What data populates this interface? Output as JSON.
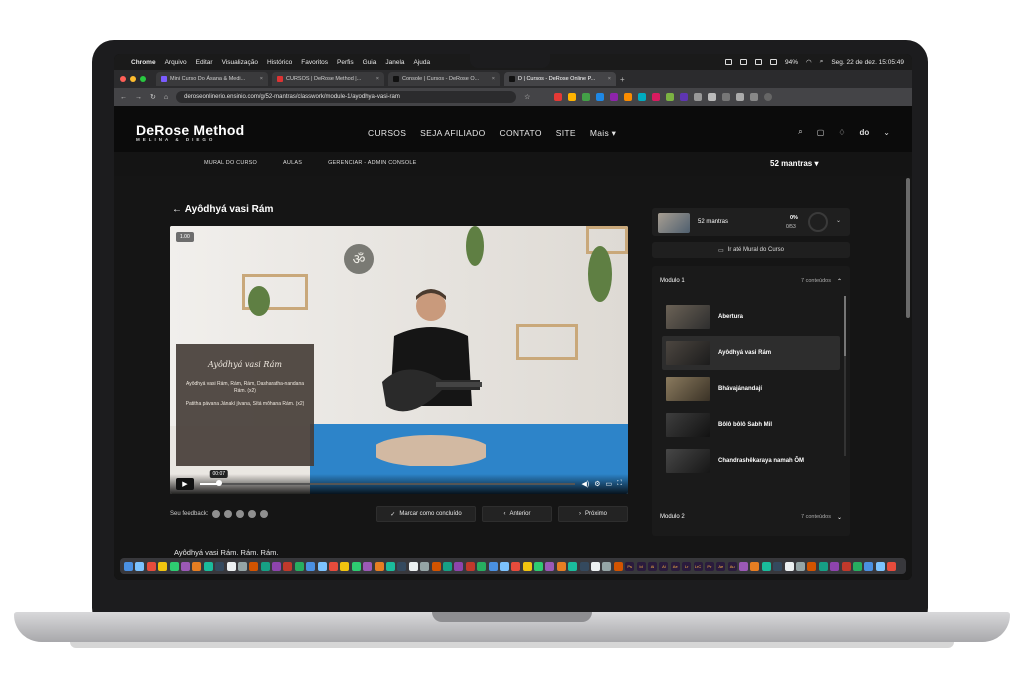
{
  "menubar": {
    "app": "Chrome",
    "items": [
      "Arquivo",
      "Editar",
      "Visualização",
      "Histórico",
      "Favoritos",
      "Perfis",
      "Guia",
      "Janela",
      "Ajuda"
    ],
    "battery": "94%",
    "datetime": "Seg. 22 de dez.  15:05:49"
  },
  "tabs": [
    {
      "label": "Mini Curso Do Ásana & Medi..."
    },
    {
      "label": "CURSOS | DeRose Method |..."
    },
    {
      "label": "Console | Cursos - DeRose O..."
    },
    {
      "label": "D | Cursos - DeRose Online P..."
    }
  ],
  "address": {
    "url": "deroseonlinerio.ensinio.com/g/52-mantras/classwork/module-1/ayodhya-vasi-ram"
  },
  "site": {
    "logo": "DeRose Method",
    "logo_sub": "MELINA & DIEGO",
    "nav": [
      "CURSOS",
      "SEJA AFILIADO",
      "CONTATO",
      "SITE",
      "Mais ▾"
    ],
    "avatar_text": "do"
  },
  "subnav": {
    "links": [
      "MURAL DO CURSO",
      "AULAS",
      "GERENCIAR - ADMIN CONSOLE"
    ],
    "course_selector": "52 mantras  ▾"
  },
  "lesson": {
    "title": "Ayôdhyá vasi Rám",
    "video_badge": "1.00",
    "card_title": "Ayôdhyá vasi Rám",
    "card_verse1": "Ayôdhyá vasi Rám, Rám, Rám, Dasharatha-nandana Rám. (x2)",
    "card_verse2": "Patitha pávana Jánakí jívana, Sítá môhana Rám. (x2)",
    "time_tooltip": "00:07",
    "progress_fraction": 0.05,
    "feedback_label": "Seu feedback:",
    "mark_done": "Marcar como concluído",
    "prev": "Anterior",
    "next": "Próximo",
    "body_text": "Ayôdhyá vasi Rám. Rám. Rám."
  },
  "panel": {
    "course_name": "52 mantras",
    "percent": "0%",
    "count": "0/53",
    "mural_button": "Ir até Mural do Curso",
    "module1": {
      "title": "Modulo 1",
      "count": "7 conteúdos",
      "lessons": [
        "Abertura",
        "Ayôdhyá vasi Rám",
        "Bhávajánandají",
        "Bôlô bôlô Sabh Mil",
        "Chandrashêkaraya namah ÔM"
      ]
    },
    "module2": {
      "title": "Modulo 2",
      "count": "7 conteúdos"
    }
  },
  "colors": {
    "page_bg": "#151515",
    "header_bg": "#0b0b0b",
    "accent_floor": "#2d84c9"
  },
  "dock": {
    "app_labels": [
      "Ps",
      "Id",
      "Ai",
      "Ai",
      "Ae",
      "Lr",
      "LrC",
      "Pr",
      "Ae",
      "Au"
    ]
  }
}
